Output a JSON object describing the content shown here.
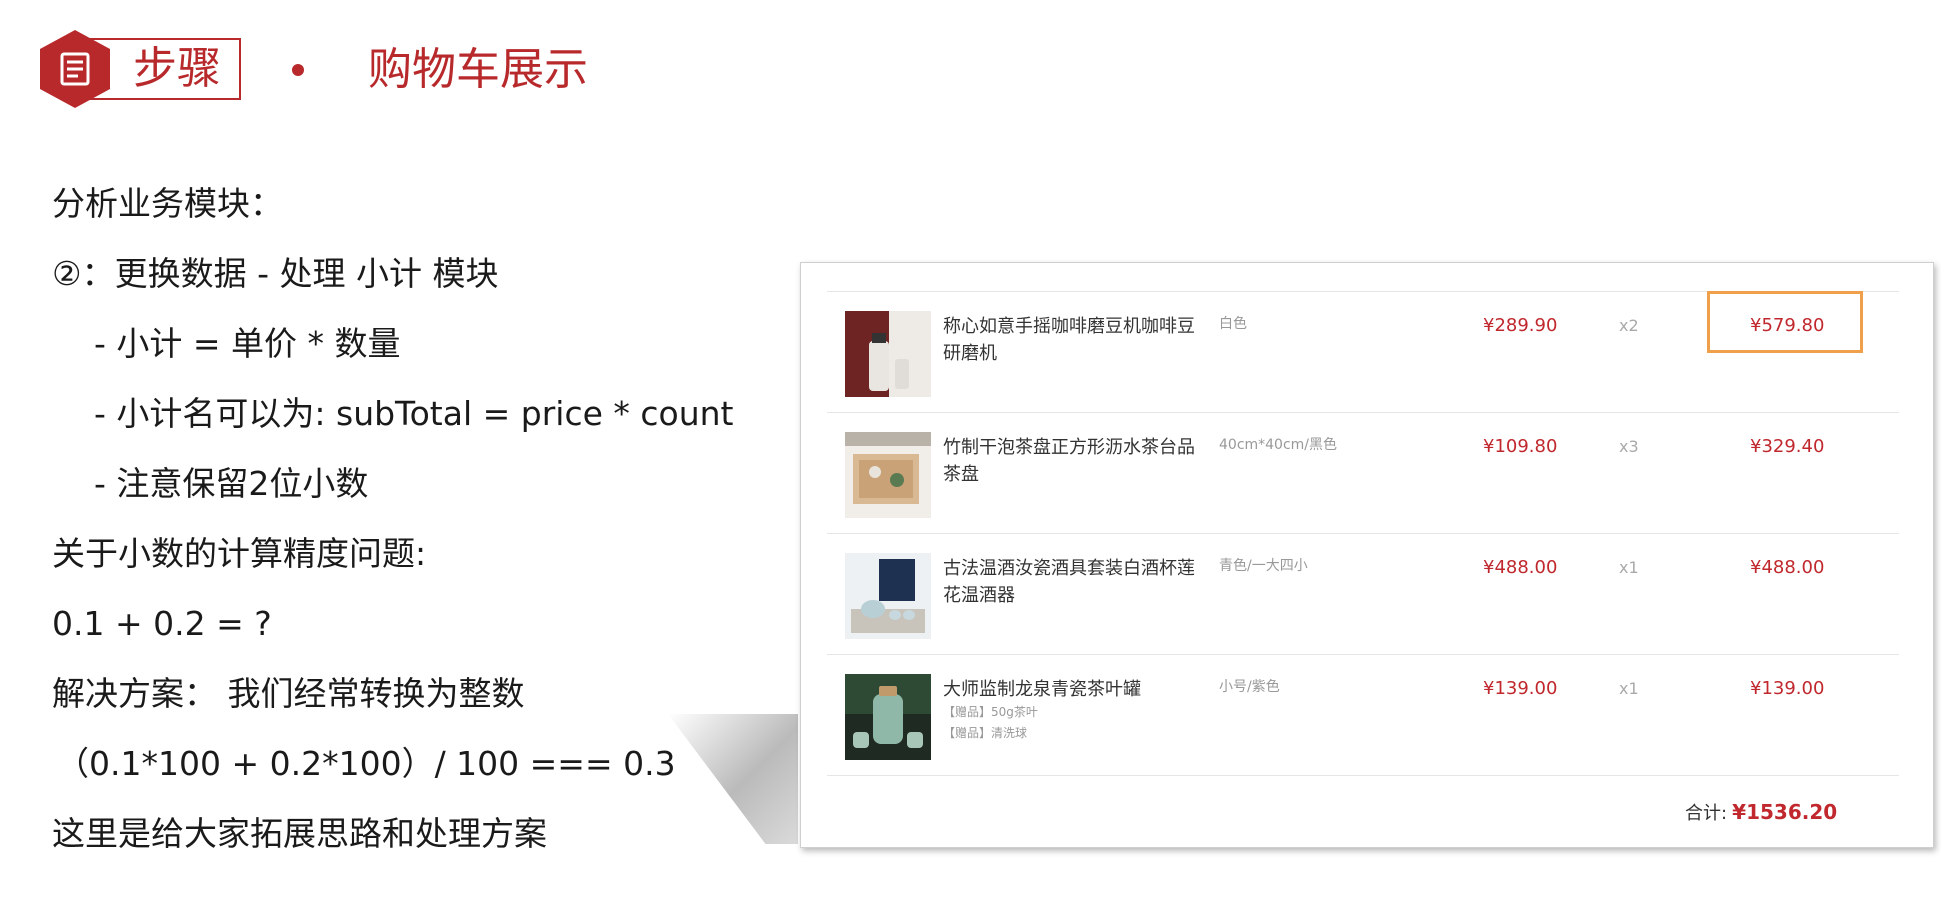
{
  "header": {
    "badge": "步骤",
    "title": "购物车展示",
    "accent_color": "#b8292c",
    "badge_icon": "document-icon"
  },
  "content": {
    "lines": [
      "分析业务模块：",
      "②：更换数据 - 处理 小计 模块",
      "-  小计 =  单价 *  数量",
      "-  小计名可以为: subTotal  =  price * count",
      "-  注意保留2位小数",
      "关于小数的计算精度问题:",
      "0.1 + 0.2 = ?",
      "解决方案：  我们经常转换为整数",
      "（0.1*100 + 0.2*100）/ 100  === 0.3",
      "这里是给大家拓展思路和处理方案"
    ]
  },
  "cart": {
    "items": [
      {
        "name": "称心如意手摇咖啡磨豆机咖啡豆研磨机",
        "spec": "白色",
        "price": "¥289.90",
        "qty": "x2",
        "subtotal": "¥579.80",
        "gifts": []
      },
      {
        "name": "竹制干泡茶盘正方形沥水茶台品茶盘",
        "spec": "40cm*40cm/黑色",
        "price": "¥109.80",
        "qty": "x3",
        "subtotal": "¥329.40",
        "gifts": []
      },
      {
        "name": "古法温酒汝瓷酒具套装白酒杯莲花温酒器",
        "spec": "青色/一大四小",
        "price": "¥488.00",
        "qty": "x1",
        "subtotal": "¥488.00",
        "gifts": []
      },
      {
        "name": "大师监制龙泉青瓷茶叶罐",
        "spec": "小号/紫色",
        "price": "¥139.00",
        "qty": "x1",
        "subtotal": "¥139.00",
        "gifts": [
          "【赠品】50g茶叶",
          "【赠品】清洗球"
        ]
      }
    ],
    "total_label": "合计:",
    "total_value": "¥1536.20",
    "price_color": "#c0282d",
    "highlight_color": "#f0a04a"
  }
}
